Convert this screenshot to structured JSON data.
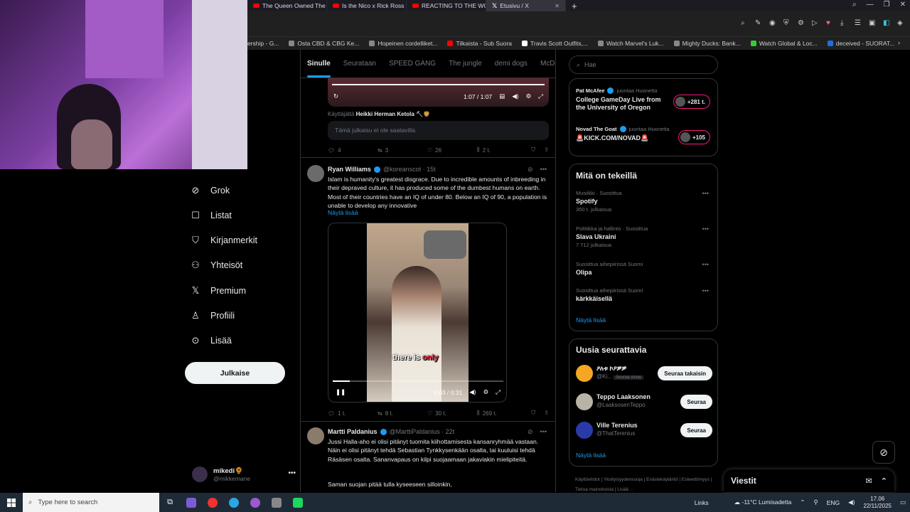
{
  "browser": {
    "tabs": [
      {
        "label": "The Queen Owned The M",
        "icon": "youtube-icon"
      },
      {
        "label": "Is the Nico x Rick Ross fal",
        "icon": "youtube-icon"
      },
      {
        "label": "REACTING TO THE WORST",
        "icon": "youtube-icon"
      },
      {
        "label": "Etusivu / X",
        "icon": "x-logo-icon",
        "active": true
      }
    ],
    "bookmarks": [
      "ership - G...",
      "Osta CBD & CBG Ke...",
      "Hopeinen cordelliket...",
      "Tilkaista - Sub Suora",
      "Travis Scott Outfits,...",
      "Watch Marvel's Luk...",
      "Mighty Ducks: Bank...",
      "Watch Global & Loc...",
      "deceived - SUORAT..."
    ]
  },
  "nav": {
    "items": [
      {
        "label": "Grok",
        "icon": "grok-icon"
      },
      {
        "label": "Listat",
        "icon": "lists-icon"
      },
      {
        "label": "Kirjanmerkit",
        "icon": "bookmark-icon"
      },
      {
        "label": "Yhteisöt",
        "icon": "communities-icon"
      },
      {
        "label": "Premium",
        "icon": "x-logo-icon"
      },
      {
        "label": "Profiili",
        "icon": "profile-icon"
      },
      {
        "label": "Lisää",
        "icon": "more-circle-icon"
      }
    ],
    "post_button": "Julkaise",
    "user": {
      "name": "mikedi🌻",
      "handle": "@mikkemane"
    }
  },
  "feed": {
    "tabs": [
      "Sinulle",
      "Seurataan",
      "SPEED GANG",
      "The jungle",
      "demi dogs",
      "McDonalds"
    ],
    "prev_video_time": "1:07 / 1:07",
    "reposted_by_prefix": "Käyttäjältä",
    "reposted_by": "Heikki Herman Ketola 🔨🦁",
    "unavailable": "Tämä julkaisu ei ole saatavilla.",
    "prev_actions": {
      "replies": "4",
      "reposts": "3",
      "likes": "26",
      "views": "2 t."
    },
    "post1": {
      "name": "Ryan Williams",
      "handle": "@koreanscot · 15t",
      "text": "Islam is humanity's greatest disgrace. Due to incredible amounts of inbreeding in their depraved culture, it has produced some of the dumbest humans on earth. Most of their countries have an IQ of under 80. Below an IQ of 90, a population is unable to develop any innovative",
      "show_more": "Näytä lisää",
      "caption_a": "there is ",
      "caption_b": "only",
      "video_time": "0:03 / 0:31",
      "video_progress": 0.1,
      "actions": {
        "replies": "1 t.",
        "reposts": "8 t.",
        "likes": "30 t.",
        "views": "269 t."
      }
    },
    "post2": {
      "name": "Martti Paldanius",
      "handle": "@MarttiPaldanius · 22t",
      "text": "Jussi Halla-aho ei olisi pitänyt tuomita kiihottamisesta kansanryhmää vastaan. Näin ei olisi pitänyt tehdä Sebastian Tynkkysenkään osalta, tai kuuluisi tehdä Räsäsen osalta. Sananvapaus on kilpi suojaamaan jakaviakin mielipiteitä.",
      "text2": "Saman suojan pitää tulla kyseeseen silloinkin,"
    }
  },
  "right": {
    "search_placeholder": "Hae",
    "live": [
      {
        "host": "Pat McAfee",
        "sub": "juontaa Huonetta",
        "title": "College GameDay Live from the University of Oregon",
        "count": "+281 t."
      },
      {
        "host": "Novad The Goat",
        "sub": "juontaa Huonetta",
        "title": "🚨KICK.COM/NOVAD🚨",
        "count": "+105"
      }
    ],
    "trending_title": "Mitä on tekeillä",
    "trends": [
      {
        "ctx": "Musiikki · Suosittua",
        "name": "Spotify",
        "count": "350 t. julkaisua"
      },
      {
        "ctx": "Politiikka ja hallinto · Suosittua",
        "name": "Slava Ukraini",
        "count": "7 712 julkaisua"
      },
      {
        "ctx": "Suosittua aihepiirissä Suomi",
        "name": "Olipa",
        "count": ""
      },
      {
        "ctx": "Suosittua aihepiirissä Suomi",
        "name": "kärkkäisellä",
        "count": ""
      }
    ],
    "show_more": "Näytä lisää",
    "who_title": "Uusia seurattavia",
    "who": [
      {
        "name": "ዖለቱ ኮዖቓቓ",
        "handle": "@Ki...",
        "tag": "Seuraa sinua",
        "button": "Seuraa takaisin"
      },
      {
        "name": "Teppo Laaksonen",
        "handle": "@LaaksosenTeppo",
        "tag": "",
        "button": "Seuraa"
      },
      {
        "name": "Ville Terenius",
        "handle": "@ThatTerenius",
        "tag": "",
        "button": "Seuraa"
      }
    ],
    "footer": [
      "Käyttöehdot",
      "Yksityisyydensuoja",
      "Evästekäytäntö",
      "Esteettömyys",
      "Tietoa mainoksista",
      "Lisää ···"
    ],
    "messages": "Viestit"
  },
  "taskbar": {
    "search_placeholder": "Type here to search",
    "links": "Links",
    "weather": "-11°C  Lumisadetta",
    "lang": "ENG",
    "time": "17.06",
    "date": "22/11/2025"
  }
}
